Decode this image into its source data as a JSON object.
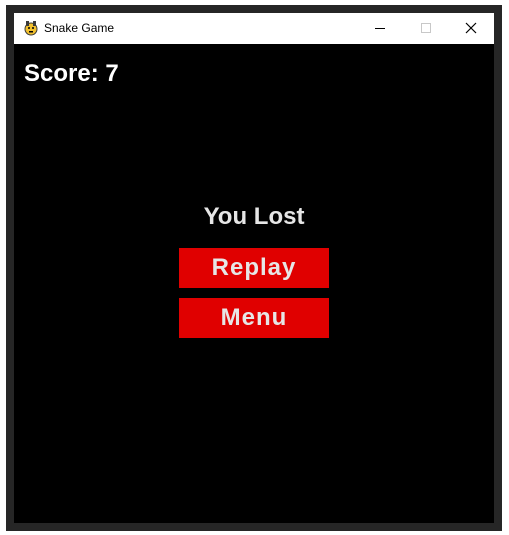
{
  "window": {
    "title": "Snake Game",
    "app_icon": "pygame-snake-icon",
    "controls": {
      "minimize_icon": "minimize-icon",
      "maximize_icon": "maximize-icon",
      "close_icon": "close-icon"
    }
  },
  "game": {
    "score_text": "Score: 7",
    "status_text": "You Lost",
    "buttons": {
      "replay_label": "Replay",
      "menu_label": "Menu"
    }
  },
  "colors": {
    "background": "#000000",
    "button": "#e00000",
    "button_text": "#e6e6e6",
    "score_text": "#ffffff",
    "window_frame": "#262626"
  }
}
